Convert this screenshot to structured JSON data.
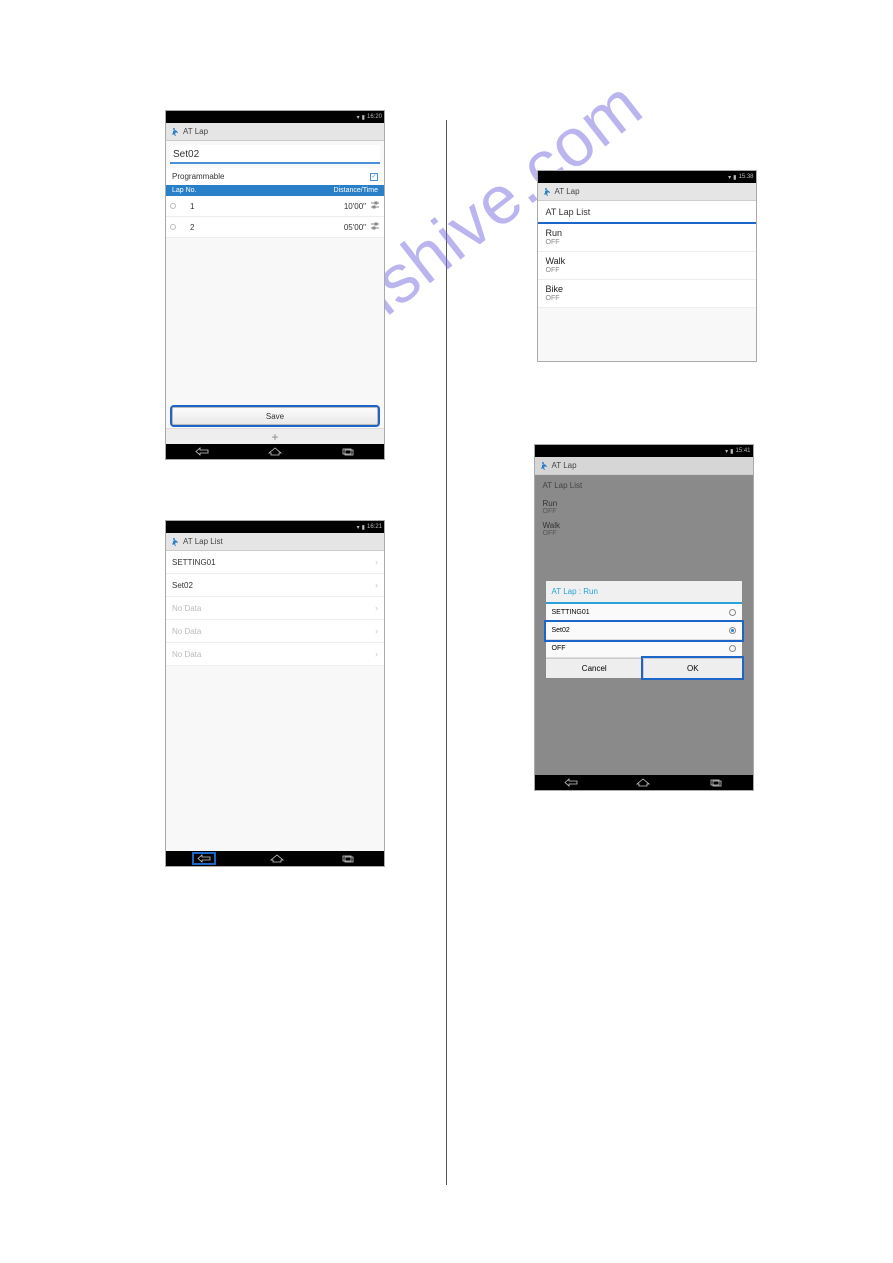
{
  "watermark": "manualshive.com",
  "phone1": {
    "statusbar_time": "16:20",
    "app_title": "AT Lap",
    "set_name": "Set02",
    "programmable_label": "Programmable",
    "lap_header_no": "Lap No.",
    "lap_header_dt": "Distance/Time",
    "laps": [
      {
        "no": "1",
        "dt": "10'00\""
      },
      {
        "no": "2",
        "dt": "05'00\""
      }
    ],
    "save_label": "Save",
    "add_label": "+"
  },
  "phone2": {
    "statusbar_time": "16:21",
    "app_title": "AT Lap List",
    "items": [
      {
        "label": "SETTING01"
      },
      {
        "label": "Set02"
      },
      {
        "label": "No Data",
        "dim": true
      },
      {
        "label": "No Data",
        "dim": true
      },
      {
        "label": "No Data",
        "dim": true
      }
    ]
  },
  "phone3": {
    "statusbar_time": "15:38",
    "app_title": "AT Lap",
    "section": "AT Lap List",
    "items": [
      {
        "l1": "Run",
        "l2": "OFF"
      },
      {
        "l1": "Walk",
        "l2": "OFF"
      },
      {
        "l1": "Bike",
        "l2": "OFF"
      }
    ]
  },
  "phone4": {
    "statusbar_time": "15:41",
    "app_title": "AT Lap",
    "section": "AT Lap List",
    "under_items": [
      {
        "l1": "Run",
        "l2": "OFF"
      },
      {
        "l1": "Walk",
        "l2": "OFF"
      }
    ],
    "dialog_title": "AT Lap : Run",
    "dialog_options": [
      {
        "label": "SETTING01",
        "selected": false
      },
      {
        "label": "Set02",
        "selected": true
      },
      {
        "label": "OFF",
        "selected": false
      }
    ],
    "cancel_label": "Cancel",
    "ok_label": "OK"
  }
}
